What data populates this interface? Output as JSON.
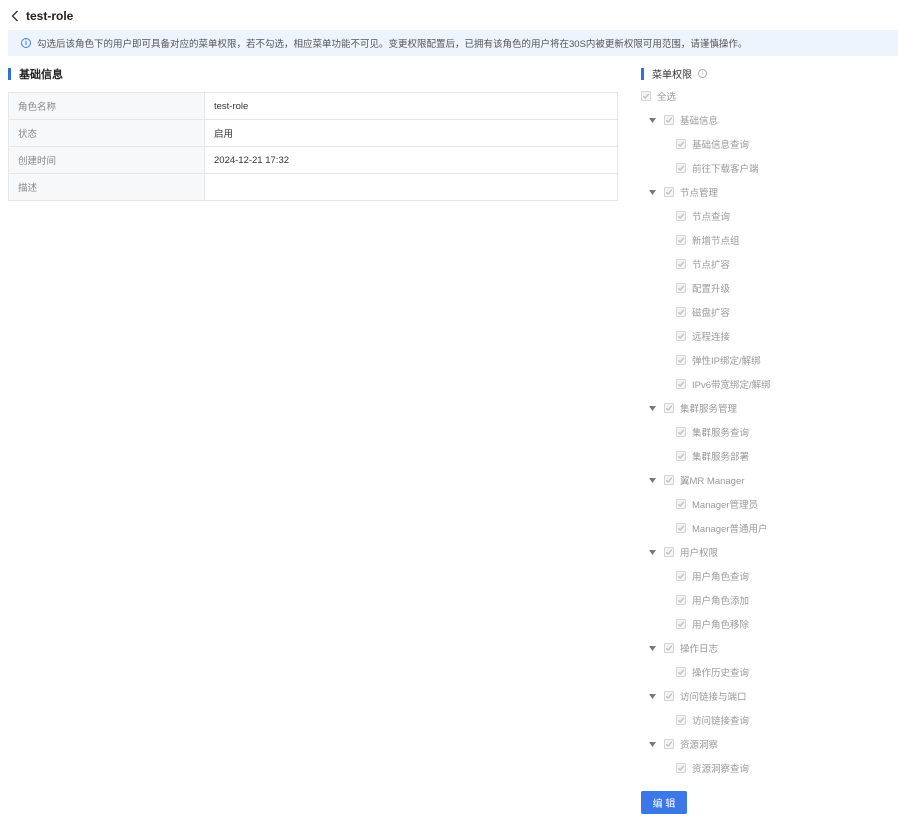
{
  "header": {
    "title": "test-role"
  },
  "notice": {
    "text": "勾选后该角色下的用户即可具备对应的菜单权限，若不勾选，相应菜单功能不可见。变更权限配置后，已拥有该角色的用户将在30S内被更新权限可用范围，请谨慎操作。"
  },
  "basic_info": {
    "title": "基础信息",
    "rows": [
      {
        "label": "角色名称",
        "value": "test-role"
      },
      {
        "label": "状态",
        "value": "启用"
      },
      {
        "label": "创建时间",
        "value": "2024-12-21 17:32"
      },
      {
        "label": "描述",
        "value": ""
      }
    ]
  },
  "menu_permissions": {
    "title": "菜单权限",
    "select_all": "全选",
    "groups": [
      {
        "label": "基础信息",
        "children": [
          "基础信息查询",
          "前往下载客户端"
        ]
      },
      {
        "label": "节点管理",
        "children": [
          "节点查询",
          "新增节点组",
          "节点扩容",
          "配置升级",
          "磁盘扩容",
          "远程连接",
          "弹性IP绑定/解绑",
          "IPv6带宽绑定/解绑"
        ]
      },
      {
        "label": "集群服务管理",
        "children": [
          "集群服务查询",
          "集群服务部署"
        ]
      },
      {
        "label": "翼MR Manager",
        "children": [
          "Manager管理员",
          "Manager普通用户"
        ]
      },
      {
        "label": "用户权限",
        "children": [
          "用户角色查询",
          "用户角色添加",
          "用户角色移除"
        ]
      },
      {
        "label": "操作日志",
        "children": [
          "操作历史查询"
        ]
      },
      {
        "label": "访问链接与端口",
        "children": [
          "访问链接查询"
        ]
      },
      {
        "label": "资源洞察",
        "children": [
          "资源洞察查询"
        ]
      }
    ]
  },
  "actions": {
    "edit_label": "编 辑"
  }
}
